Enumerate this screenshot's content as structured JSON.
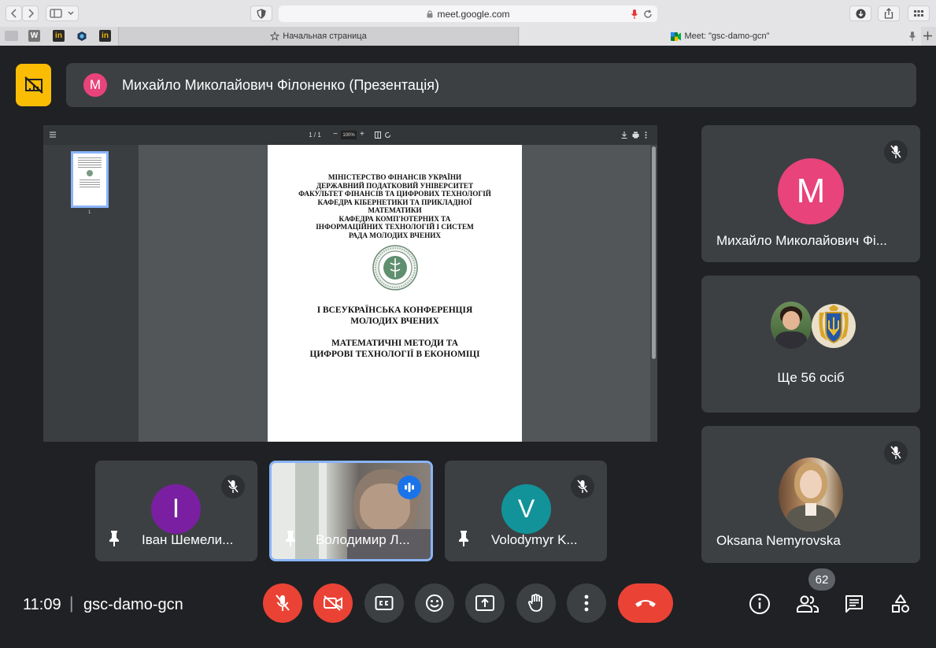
{
  "browser": {
    "url": "meet.google.com",
    "tabs": [
      {
        "label": "Начальная страница"
      },
      {
        "label": "Meet: \"gsc-damo-gcn\""
      }
    ],
    "bookmarks": [
      "W",
      "in",
      "",
      "in"
    ]
  },
  "presentation": {
    "presenter_initial": "М",
    "title": "Михайло Миколайович Філоненко (Презентація)",
    "accent": "#fbbc04"
  },
  "pdf_viewer": {
    "page_indicator": "1 / 1",
    "zoom": "100%",
    "thumbnail_label": "1",
    "document": {
      "header_lines": [
        "МІНІСТЕРСТВО ФІНАНСІВ УКРАЇНИ",
        "ДЕРЖАВНИЙ ПОДАТКОВИЙ УНІВЕРСИТЕТ",
        "ФАКУЛЬТЕТ ФІНАНСІВ ТА ЦИФРОВИХ ТЕХНОЛОГІЙ",
        "КАФЕДРА КІБЕРНЕТИКИ ТА ПРИКЛАДНОЇ",
        "МАТЕМАТИКИ",
        "КАФЕДРА КОМП'ЮТЕРНИХ ТА",
        "ІНФОРМАЦІЙНИХ ТЕХНОЛОГІЙ І СИСТЕМ",
        "РАДА МОЛОДИХ ВЧЕНИХ"
      ],
      "conference_lines": [
        "І ВСЕУКРАЇНСЬКА КОНФЕРЕНЦІЯ",
        "МОЛОДИХ ВЧЕНИХ"
      ],
      "topic_lines": [
        "МАТЕМАТИЧНІ МЕТОДИ ТА",
        "ЦИФРОВІ ТЕХНОЛОГІЇ В ЕКОНОМІЦІ"
      ]
    }
  },
  "side_tiles": {
    "presenter": {
      "initial": "М",
      "name": "Михайло Миколайович Фі...",
      "color": "#e8437a"
    },
    "others": {
      "label": "Ще 56 осіб"
    },
    "oksana": {
      "name": "Oksana Nemyrovska"
    }
  },
  "bottom_tiles": [
    {
      "initial": "І",
      "name": "Іван Шемели...",
      "color": "#7b1fa2"
    },
    {
      "initial": "",
      "name": "Володимир Л...",
      "color": ""
    },
    {
      "initial": "V",
      "name": "Volodymyr K...",
      "color": "#12939a"
    }
  ],
  "footer": {
    "time": "11:09",
    "separator": "|",
    "meeting_code": "gsc-damo-gcn",
    "participants_count": "62"
  },
  "colors": {
    "background": "#202124",
    "tile": "#3c4043",
    "danger": "#ea4335",
    "speaking": "#1a73e8"
  }
}
